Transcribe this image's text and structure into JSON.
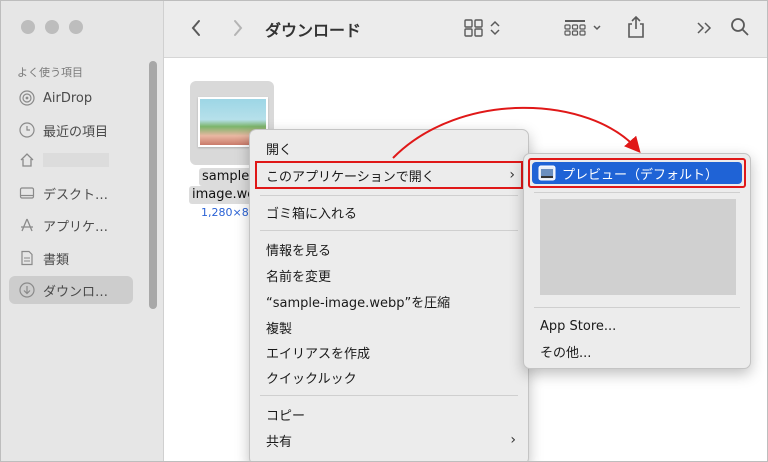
{
  "window": {
    "title": "ダウンロード"
  },
  "sidebar": {
    "section": "よく使う項目",
    "items": [
      {
        "label": "AirDrop",
        "icon": "airdrop-icon"
      },
      {
        "label": "最近の項目",
        "icon": "clock-icon"
      },
      {
        "label": "",
        "icon": "home-icon"
      },
      {
        "label": "デスクト…",
        "icon": "desktop-icon"
      },
      {
        "label": "アプリケ…",
        "icon": "applications-icon"
      },
      {
        "label": "書類",
        "icon": "document-icon"
      },
      {
        "label": "ダウンロ…",
        "icon": "download-icon"
      }
    ]
  },
  "file": {
    "name_line1": "sample",
    "name_line2": "image.we",
    "meta": "1,280×8"
  },
  "context_menu": {
    "open": "開く",
    "open_with": "このアプリケーションで開く",
    "trash": "ゴミ箱に入れる",
    "get_info": "情報を見る",
    "rename": "名前を変更",
    "compress": "“sample-image.webp”を圧縮",
    "duplicate": "複製",
    "alias": "エイリアスを作成",
    "quicklook": "クイックルック",
    "copy": "コピー",
    "share": "共有"
  },
  "submenu": {
    "preview": "プレビュー（デフォルト）",
    "app_store": "App Store...",
    "other": "その他..."
  },
  "colors": {
    "highlight": "#1f63d6",
    "annotation": "#e01818"
  }
}
